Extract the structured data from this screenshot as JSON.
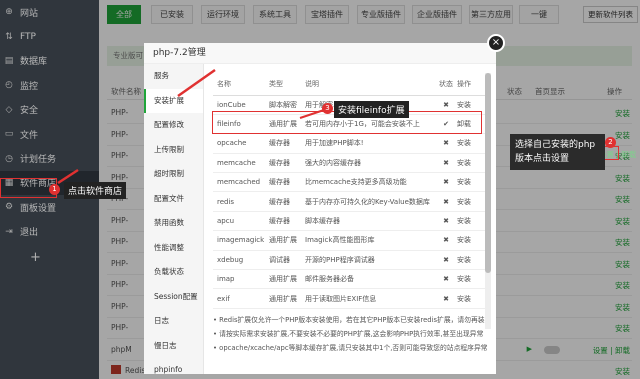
{
  "sidebar": {
    "items": [
      {
        "label": "网站",
        "icon": "globe-icon",
        "glyph": "⊕"
      },
      {
        "label": "FTP",
        "icon": "ftp-icon",
        "glyph": "⇅"
      },
      {
        "label": "数据库",
        "icon": "database-icon",
        "glyph": "▤"
      },
      {
        "label": "监控",
        "icon": "monitor-icon",
        "glyph": "◴"
      },
      {
        "label": "安全",
        "icon": "shield-icon",
        "glyph": "◇"
      },
      {
        "label": "文件",
        "icon": "folder-icon",
        "glyph": "▭"
      },
      {
        "label": "计划任务",
        "icon": "clock-icon",
        "glyph": "◷"
      },
      {
        "label": "软件商店",
        "icon": "grid-icon",
        "glyph": "▦"
      },
      {
        "label": "面板设置",
        "icon": "settings-icon",
        "glyph": "⚙"
      },
      {
        "label": "退出",
        "icon": "exit-icon",
        "glyph": "⇥"
      }
    ],
    "add": "+"
  },
  "topbar": {
    "buttons": [
      "全部",
      "已安装",
      "运行环境",
      "系统工具",
      "宝塔插件",
      "专业版插件",
      "企业版插件",
      "第三方应用",
      "一键"
    ],
    "update_tip": "更新软件列表"
  },
  "background": {
    "pro_text": "专业版可",
    "head": {
      "name": "软件名称",
      "status": "状态",
      "home": "首页显示",
      "action": "操作"
    },
    "rows": [
      {
        "name": "PHP-",
        "action": "安装"
      },
      {
        "name": "PHP-",
        "action": "安装"
      },
      {
        "name": "PHP-",
        "action": "安装"
      },
      {
        "name": "PHP-",
        "action": "安装"
      },
      {
        "name": "PHP-",
        "action": "安装"
      },
      {
        "name": "PHP-",
        "action": "安装"
      },
      {
        "name": "PHP-",
        "action": "安装"
      },
      {
        "name": "PHP-",
        "action": "安装"
      },
      {
        "name": "PHP-",
        "action": "安装"
      },
      {
        "name": "PHP-",
        "action": "安装"
      },
      {
        "name": "PHP-",
        "action": "安装"
      },
      {
        "name": "phpM",
        "action": "设置 | 卸载"
      },
      {
        "name": "Redis",
        "action": "安装"
      }
    ],
    "highlight_action": "设置 | 卸载"
  },
  "modal": {
    "title": "php-7.2管理",
    "close": "×",
    "menu": [
      "服务",
      "安装扩展",
      "配置修改",
      "上传限制",
      "超时限制",
      "配置文件",
      "禁用函数",
      "性能调整",
      "负载状态",
      "Session配置",
      "日志",
      "慢日志",
      "phpinfo"
    ],
    "table": {
      "headers": [
        "名称",
        "类型",
        "说明",
        "状态",
        "操作"
      ],
      "rows": [
        {
          "name": "ionCube",
          "type": "脚本解密",
          "desc": "用于解密...",
          "status": "✖",
          "action": "安装"
        },
        {
          "name": "fileinfo",
          "type": "通用扩展",
          "desc": "若可用内存小于1G，可能会安装不上",
          "status": "✔",
          "action": "卸载"
        },
        {
          "name": "opcache",
          "type": "缓存器",
          "desc": "用于加速PHP脚本!",
          "status": "✖",
          "action": "安装"
        },
        {
          "name": "memcache",
          "type": "缓存器",
          "desc": "强大的内容缓存器",
          "status": "✖",
          "action": "安装"
        },
        {
          "name": "memcached",
          "type": "缓存器",
          "desc": "比memcache支持更多高级功能",
          "status": "✖",
          "action": "安装"
        },
        {
          "name": "redis",
          "type": "缓存器",
          "desc": "基于内存亦可持久化的Key-Value数据库",
          "status": "✖",
          "action": "安装"
        },
        {
          "name": "apcu",
          "type": "缓存器",
          "desc": "脚本缓存器",
          "status": "✖",
          "action": "安装"
        },
        {
          "name": "imagemagick",
          "type": "通用扩展",
          "desc": "Imagick高性能图形库",
          "status": "✖",
          "action": "安装"
        },
        {
          "name": "xdebug",
          "type": "调试器",
          "desc": "开源的PHP程序调试器",
          "status": "✖",
          "action": "安装"
        },
        {
          "name": "imap",
          "type": "通用扩展",
          "desc": "邮件服务器必备",
          "status": "✖",
          "action": "安装"
        },
        {
          "name": "exif",
          "type": "通用扩展",
          "desc": "用于读取图片EXIF信息",
          "status": "✖",
          "action": "安装"
        }
      ]
    },
    "notes": [
      "Redis扩展仅允许一个PHP版本安装使用，若在其它PHP版本已安装redis扩展，请勿再装",
      "请按实际需求安装扩展,不要安装不必要的PHP扩展,这会影响PHP执行效率,甚至出现异常",
      "opcache/xcache/apc等脚本缓存扩展,请只安装其中1个,否则可能导致您的站点程序异常"
    ]
  },
  "annotations": {
    "step1": {
      "num": "1",
      "text": "点击软件商店"
    },
    "step2": {
      "num": "2",
      "text": "选择自己安装的php版本点击设置"
    },
    "step3": {
      "num": "3",
      "text": "安装fileinfo扩展"
    }
  },
  "colors": {
    "accent": "#20a53a",
    "danger": "#e03131",
    "sidebar": "#3c444d"
  }
}
